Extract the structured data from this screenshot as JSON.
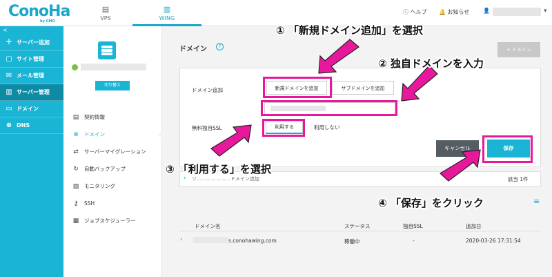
{
  "header": {
    "logo": "ConoHa",
    "logo_sub": "by GMO",
    "tabs": [
      {
        "label": "VPS",
        "icon": "server-icon"
      },
      {
        "label": "WING",
        "icon": "wing-icon"
      }
    ],
    "help": "ヘルプ",
    "notice": "お知らせ"
  },
  "sidebar": {
    "back": "<",
    "items": [
      {
        "label": "サーバー追加",
        "icon": "plus-icon"
      },
      {
        "label": "サイト管理",
        "icon": "site-icon"
      },
      {
        "label": "メール管理",
        "icon": "mail-icon"
      },
      {
        "label": "サーバー管理",
        "icon": "server-manage-icon",
        "active": true
      },
      {
        "label": "ドメイン",
        "icon": "domain-icon"
      },
      {
        "label": "DNS",
        "icon": "globe-icon"
      }
    ]
  },
  "submenu": {
    "switch_label": "切り替え",
    "items": [
      {
        "label": "契約情報",
        "icon": "contract-icon"
      },
      {
        "label": "ドメイン",
        "icon": "globe-icon",
        "active": true
      },
      {
        "label": "サーバーマイグレーション",
        "icon": "migration-icon"
      },
      {
        "label": "自動バックアップ",
        "icon": "backup-icon"
      },
      {
        "label": "モニタリング",
        "icon": "monitoring-icon"
      },
      {
        "label": "SSH",
        "icon": "key-icon"
      },
      {
        "label": "ジョブスケジューラー",
        "icon": "scheduler-icon"
      }
    ]
  },
  "main": {
    "title": "ドメイン",
    "add_domain_button": "+ ドメイン",
    "form": {
      "domain_add_label": "ドメイン追加",
      "new_domain_button": "新規ドメインを追加",
      "sub_domain_button": "サブドメインを追加",
      "ssl_label": "無料独自SSL",
      "use_button": "利用する",
      "no_use_button": "利用しない",
      "cancel_button": "キャンセル",
      "save_button": "保存"
    },
    "search": {
      "text": "ソ…………………ドメイン追加",
      "count": "該当 1件"
    },
    "table": {
      "headers": [
        "ドメイン名",
        "ステータス",
        "独自SSL",
        "追加日"
      ],
      "rows": [
        {
          "domain": "s.conohawing.com",
          "status": "稼働中",
          "ssl": "-",
          "date": "2020-03-26 17:31:54"
        }
      ]
    }
  },
  "annotations": {
    "step1": "① 「新規ドメイン追加」を選択",
    "step2": "② 独自ドメインを入力",
    "step3": "③ 「利用する」を選択",
    "step4": "④ 「保存」をクリック"
  },
  "colors": {
    "brand": "#1ab4d4",
    "highlight": "#e8189c",
    "arrow": "#e8189c"
  }
}
